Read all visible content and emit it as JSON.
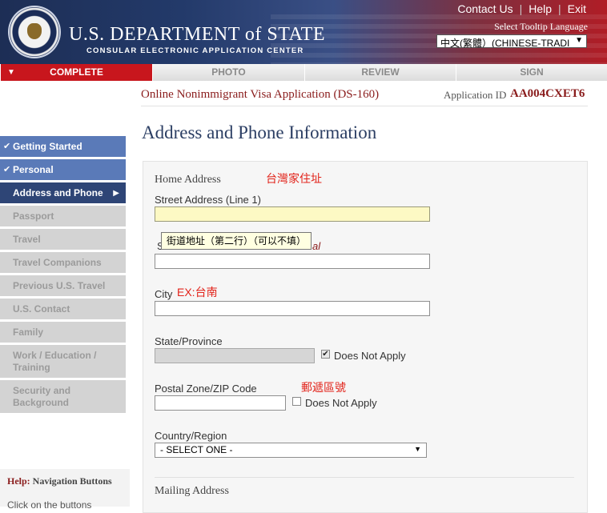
{
  "header": {
    "agency_name": "U.S. DEPARTMENT of STATE",
    "agency_sub": "CONSULAR ELECTRONIC APPLICATION CENTER",
    "links": [
      "Contact Us",
      "Help",
      "Exit"
    ],
    "tooltip_language_label": "Select Tooltip Language",
    "tooltip_language_value": "中文(繁體）(CHINESE-TRADI"
  },
  "steps": [
    "COMPLETE",
    "PHOTO",
    "REVIEW",
    "SIGN"
  ],
  "form_title": "Online Nonimmigrant Visa Application (DS-160)",
  "application_id_label": "Application ID",
  "application_id": "AA004CXET6",
  "page_title": "Address and Phone Information",
  "nav": {
    "items": [
      {
        "label": "Getting Started",
        "state": "done"
      },
      {
        "label": "Personal",
        "state": "done"
      },
      {
        "label": "Address and Phone",
        "state": "current"
      },
      {
        "label": "Passport",
        "state": "todo"
      },
      {
        "label": "Travel",
        "state": "todo"
      },
      {
        "label": "Travel Companions",
        "state": "todo"
      },
      {
        "label": "Previous U.S. Travel",
        "state": "todo"
      },
      {
        "label": "U.S. Contact",
        "state": "todo"
      },
      {
        "label": "Family",
        "state": "todo"
      },
      {
        "label": "Work / Education / Training",
        "state": "todo"
      },
      {
        "label": "Security and Background",
        "state": "todo"
      }
    ],
    "help_prefix": "Help:",
    "help_title": "Navigation Buttons",
    "help_text": "Click on the buttons"
  },
  "form": {
    "home_address_label": "Home Address",
    "home_address_note": "台灣家住址",
    "street1_label": "Street Address (Line 1)",
    "street2_tooltip": "街道地址（第二行）（可以不填）",
    "street2_label_start": "S",
    "street2_label_tail": "al",
    "city_label": "City",
    "city_note": "EX:台南",
    "state_label": "State/Province",
    "state_does_not_apply": "Does Not Apply",
    "postal_label": "Postal Zone/ZIP Code",
    "postal_note": "郵遞區號",
    "postal_does_not_apply": "Does Not Apply",
    "country_label": "Country/Region",
    "country_value": "- SELECT ONE -",
    "mailing_address_label": "Mailing Address"
  }
}
